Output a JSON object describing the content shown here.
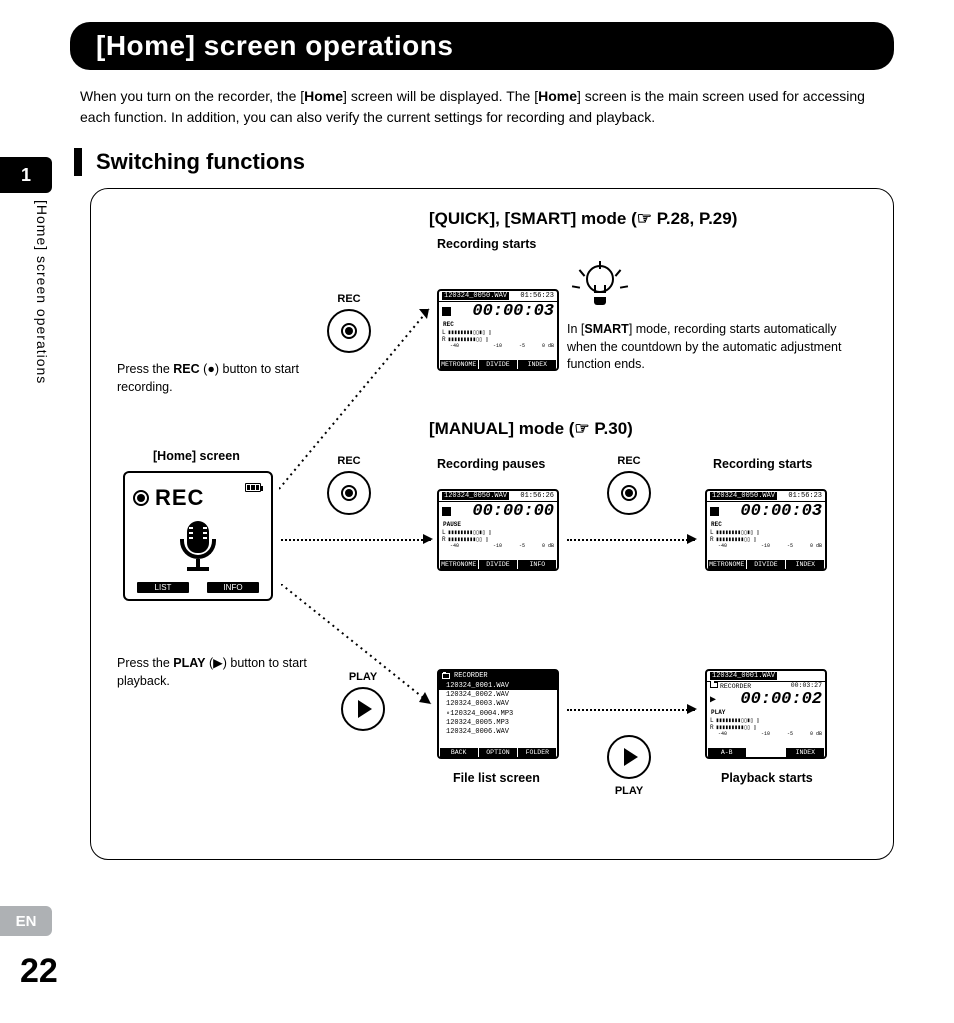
{
  "page": {
    "title": "[Home] screen operations",
    "intro_prefix": "When you turn on the recorder, the [",
    "intro_bold1": "Home",
    "intro_mid": "] screen will be displayed. The [",
    "intro_bold2": "Home",
    "intro_suffix": "] screen is the main screen used for accessing each function. In addition, you can also verify the current settings for recording and playback.",
    "section_title": "Switching functions",
    "chapter_tab": "1",
    "vertical_label": "[Home] screen operations",
    "lang_badge": "EN",
    "page_number": "22"
  },
  "headings": {
    "quick_smart": "[QUICK], [SMART] mode (☞ P.28, P.29)",
    "manual": "[MANUAL] mode (☞ P.30)"
  },
  "labels": {
    "recording_starts": "Recording starts",
    "recording_pauses": "Recording pauses",
    "home_screen": "[Home] screen",
    "file_list_screen": "File list screen",
    "playback_starts": "Playback starts",
    "rec_btn": "REC",
    "play_btn": "PLAY"
  },
  "notes": {
    "press_rec_pre": "Press the ",
    "press_rec_bold": "REC",
    "press_rec_post": " (●) button to start recording.",
    "press_play_pre": "Press the  ",
    "press_play_bold": "PLAY",
    "press_play_post": " (▶) button to start playback.",
    "smart_pre": "In [",
    "smart_bold": "SMART",
    "smart_post": "] mode, recording starts automatically when the countdown by the automatic adjustment function ends."
  },
  "home_lcd": {
    "rec_text": "REC",
    "btn1": "LIST",
    "btn2": "INFO"
  },
  "lcd_rec_a": {
    "filename": "120324_0050.WAV",
    "clock": "01:56:23",
    "mode": "REC",
    "timer": "00:00:03",
    "meter_l": "L",
    "meter_r": "R",
    "scale": [
      "-40",
      "",
      "-10",
      "-5",
      "0 dB"
    ],
    "b1": "METRONOME",
    "b2": "DIVIDE",
    "b3": "INDEX"
  },
  "lcd_pause": {
    "filename": "120324_0050.WAV",
    "clock": "01:56:26",
    "mode": "PAUSE",
    "timer": "00:00:00",
    "b1": "METRONOME",
    "b2": "DIVIDE",
    "b3": "INFO"
  },
  "lcd_rec_b": {
    "filename": "120324_0050.WAV",
    "clock": "01:56:23",
    "mode": "REC",
    "timer": "00:00:03",
    "b1": "METRONOME",
    "b2": "DIVIDE",
    "b3": "INDEX"
  },
  "filelist": {
    "folder": "RECORDER",
    "rows": [
      "120324_0001.WAV",
      "120324_0002.WAV",
      "120324_0003.WAV",
      "120324_0004.MP3",
      "120324_0005.MP3",
      "120324_0006.WAV"
    ],
    "selected_index": 0,
    "b1": "BACK",
    "b2": "OPTION",
    "b3": "FOLDER"
  },
  "lcd_play": {
    "filename": "120324_0001.WAV",
    "folder": "RECORDER",
    "clock": "00:03:27",
    "mode": "PLAY",
    "timer": "00:00:02",
    "b1": "A-B",
    "b2": "",
    "b3": "INDEX"
  }
}
